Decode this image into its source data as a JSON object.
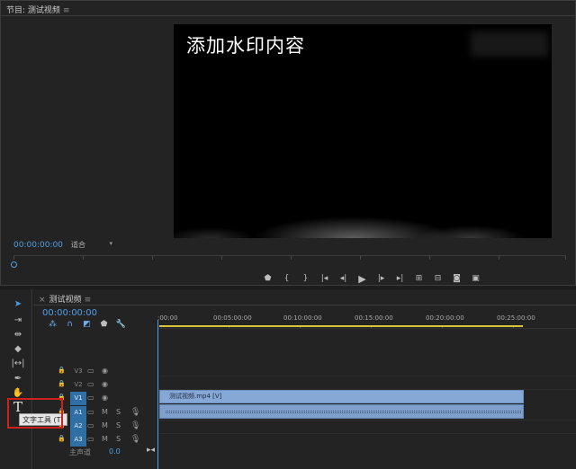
{
  "monitor": {
    "tab_label": "节目: 测试视频",
    "watermark_text": "添加水印内容",
    "timecode": "00:00:00:00",
    "fit_label": "适合",
    "transport": [
      "marker",
      "in",
      "out",
      "go-to-in",
      "step-back",
      "play",
      "step-forward",
      "go-to-out",
      "lift",
      "extract",
      "export-frame",
      "compare"
    ]
  },
  "tools": {
    "items": [
      "selection",
      "track-select",
      "ripple-edit",
      "razor",
      "slip",
      "pen",
      "hand",
      "type"
    ],
    "tooltip": "文字工具 (T)",
    "type_glyph": "T"
  },
  "timeline": {
    "tab_label": "测试视频",
    "timecode": "00:00:00:00",
    "ruler": [
      ":00:00",
      "00:05:00:00",
      "00:10:00:00",
      "00:15:00:00",
      "00:20:00:00",
      "00:25:00:00"
    ],
    "tracks": [
      {
        "name": "V3",
        "source": "",
        "type": "video"
      },
      {
        "name": "V2",
        "source": "",
        "type": "video"
      },
      {
        "name": "V1",
        "source": "V1",
        "type": "video"
      },
      {
        "name": "A1",
        "source": "A1",
        "type": "audio"
      },
      {
        "name": "A2",
        "source": "A2",
        "type": "audio"
      },
      {
        "name": "A3",
        "source": "A3",
        "type": "audio"
      }
    ],
    "audio_buttons": {
      "mute": "M",
      "solo": "S"
    },
    "master_label": "主声道",
    "master_value": "0.0",
    "video_clip_label": "测试视频.mp4 [V]"
  },
  "colors": {
    "accent": "#4f9fe6",
    "clip": "#86a8d6",
    "workbar": "#d7c63a",
    "highlight": "#d0201c"
  }
}
